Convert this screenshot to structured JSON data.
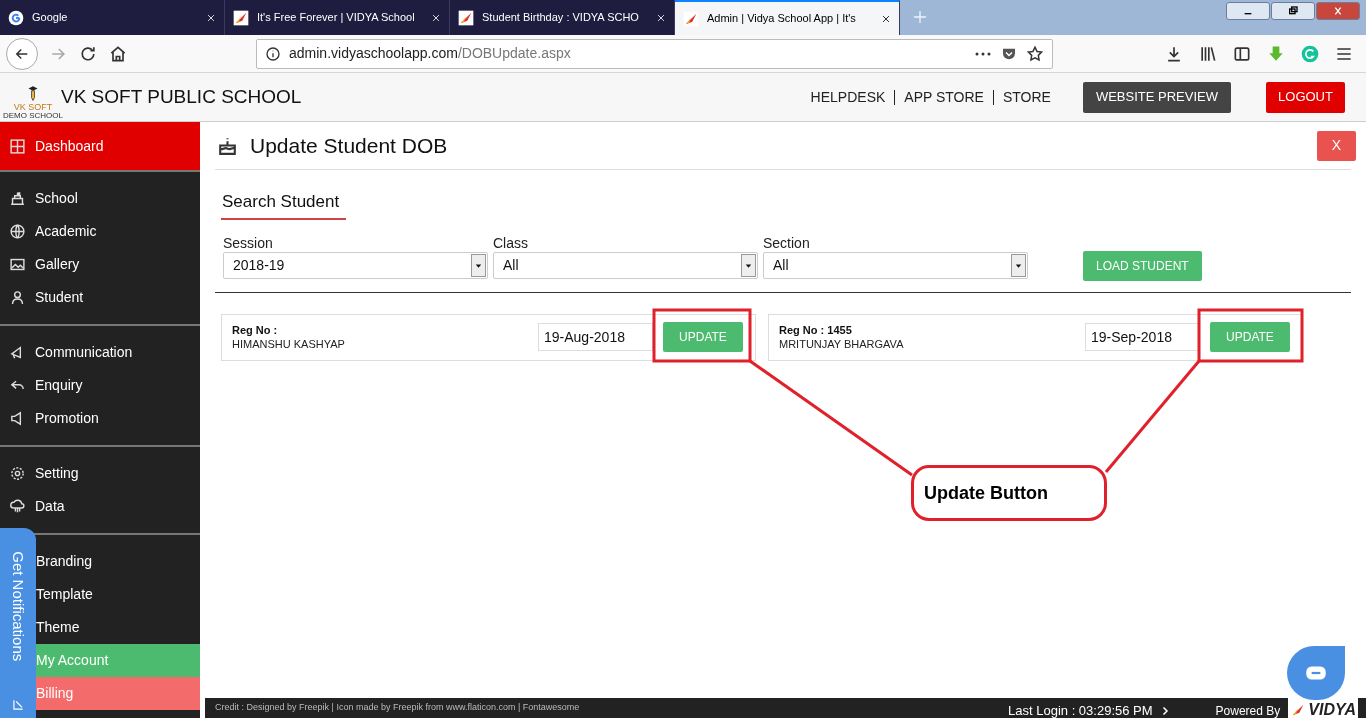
{
  "browser": {
    "tabs": [
      {
        "title": "Google",
        "selected": false
      },
      {
        "title": "It's Free Forever | VIDYA School",
        "selected": false
      },
      {
        "title": "Student Birthday : VIDYA SCHO",
        "selected": false
      },
      {
        "title": "Admin | Vidya School App | It's",
        "selected": true
      }
    ],
    "url_host": "admin.vidyaschoolapp.com",
    "url_path": "/DOBUpdate.aspx"
  },
  "header": {
    "school_name": "VK SOFT PUBLIC SCHOOL",
    "logo_text": "VK SOFT",
    "logo_subtext": "DEMO SCHOOL",
    "links": [
      "HELPDESK",
      "APP STORE",
      "STORE"
    ],
    "preview_button": "WEBSITE PREVIEW",
    "logout_button": "LOGOUT"
  },
  "sidebar": {
    "groups": [
      [
        {
          "label": "Dashboard",
          "color": "#e00000"
        }
      ],
      [
        {
          "label": "School"
        },
        {
          "label": "Academic"
        },
        {
          "label": "Gallery"
        },
        {
          "label": "Student"
        }
      ],
      [
        {
          "label": "Communication"
        },
        {
          "label": "Enquiry"
        },
        {
          "label": "Promotion"
        }
      ],
      [
        {
          "label": "Setting"
        },
        {
          "label": "Data"
        }
      ],
      [
        {
          "label": "Branding"
        },
        {
          "label": "Template"
        },
        {
          "label": "Theme"
        },
        {
          "label": "My Account",
          "color": "#4dbb6f"
        },
        {
          "label": "Billing",
          "color": "#f46b6b"
        }
      ]
    ]
  },
  "notifications_tab": "Get Notifications",
  "page": {
    "title": "Update Student DOB",
    "close_button": "X",
    "section_title": "Search Student",
    "filters": [
      {
        "label": "Session",
        "value": "2018-19"
      },
      {
        "label": "Class",
        "value": "All"
      },
      {
        "label": "Section",
        "value": "All"
      }
    ],
    "load_button": "LOAD STUDENT",
    "students": [
      {
        "reg_label": "Reg No :",
        "name": "HIMANSHU KASHYAP",
        "dob": "19-Aug-2018",
        "button": "UPDATE"
      },
      {
        "reg_label": "Reg No :",
        "reg_no": "1455",
        "name": "MRITUNJAY BHARGAVA",
        "dob": "19-Sep-2018",
        "button": "UPDATE"
      }
    ]
  },
  "annotation": {
    "label": "Update Button"
  },
  "footer": {
    "credit": "Credit : Designed by Freepik | Icon made by Freepik from www.flaticon.com | Fontawesome",
    "last_login": "Last Login : 03:29:56 PM",
    "powered_by": "Powered By",
    "brand": "VIDYA"
  }
}
